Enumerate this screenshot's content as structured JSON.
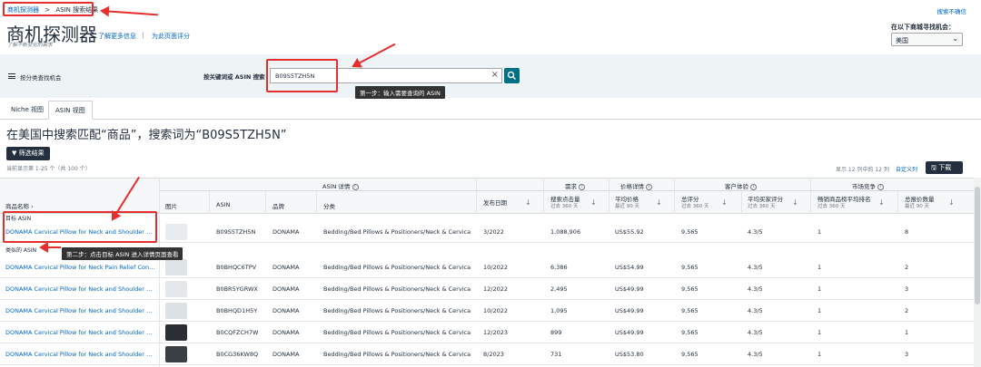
{
  "breadcrumb": {
    "home": "商机探测器",
    "sep": ">",
    "current": "ASIN 搜索结果"
  },
  "header": {
    "title": "商机探测器",
    "subtitle": "了解不断变化的需求",
    "learn_more": "了解更多信息",
    "divider": "|",
    "rate_page": "为此页面评分",
    "top_right_link": "搜索不确信",
    "marketplace_label": "在以下商城寻找机会：",
    "marketplace_value": "美国"
  },
  "searchbar": {
    "left_label": "按分类查找机会",
    "search_label": "按关键词或 ASIN 搜索",
    "search_value": "B09S5TZH5N",
    "step1_tip": "第一步：输入需要查询的 ASIN"
  },
  "tabs": [
    {
      "label": "Niche 视图"
    },
    {
      "label": "ASIN 视图"
    }
  ],
  "results": {
    "heading": "在美国中搜索匹配“商品”，搜索词为“B09S5TZH5N”",
    "filter_btn": "筛选结果",
    "count_text": "当前显示第 1-25 个（共 100 个）",
    "cols_text": "显示 12 列中的 12 列",
    "customize": "自定义列",
    "download": "下载"
  },
  "table": {
    "group_headers": {
      "asin_detail": "ASIN 详情",
      "demand": "需求",
      "price": "价格详情",
      "experience": "客户体验",
      "competition": "市场竞争"
    },
    "columns": {
      "name": "商品名称",
      "image": "图片",
      "asin": "ASIN",
      "brand": "品牌",
      "category": "分类",
      "launch": "发布日期",
      "search_volume": "搜索点击量",
      "search_volume_sub": "过去 360 天",
      "avg_price": "平均价格",
      "avg_price_sub": "最近 90 天",
      "total_ratings": "总评分",
      "total_ratings_sub": "过去 360 天",
      "avg_rating": "平均买家评分",
      "avg_rating_sub": "过去 360 天",
      "bsr": "畅销商品榜平均排名",
      "bsr_sub": "过去 360 天",
      "sellers": "总报价数量",
      "sellers_sub": "最近 90 天"
    },
    "target_label": "目标 ASIN",
    "similar_label": "类似的 ASIN",
    "step2_tip": "第二步：点击目标 ASIN 进入详情页面查看",
    "rows": [
      {
        "name": "DONAMA Cervical Pillow for Neck and Shoulder Co...",
        "asin": "B09S5TZH5N",
        "brand": "DONAMA",
        "category": "Bedding/Bed Pillows & Positioners/Neck & Cervical...",
        "launch": "3/2022",
        "volume": "1,088,906",
        "price": "US$55.92",
        "ratings": "9,565",
        "rating": "4.3/5",
        "bsr": "1",
        "offers": "8",
        "thumb": "#e8ecee"
      },
      {
        "name": "DONAMA Cervical Pillow for Neck Pain Relief Cont...",
        "asin": "B0BHQC6TPV",
        "brand": "DONAMA",
        "category": "Bedding/Bed Pillows & Positioners/Neck & Cervical...",
        "launch": "10/2022",
        "volume": "6,386",
        "price": "US$54.99",
        "ratings": "9,565",
        "rating": "4.3/5",
        "bsr": "1",
        "offers": "2",
        "thumb": "#dfe4e6"
      },
      {
        "name": "DONAMA Cervical Pillow for Neck and Shoulder Co...",
        "asin": "B0BR5YGRWX",
        "brand": "DONAMA",
        "category": "Bedding/Bed Pillows & Positioners/Neck & Cervical...",
        "launch": "12/2022",
        "volume": "2,495",
        "price": "US$49.99",
        "ratings": "9,565",
        "rating": "4.3/5",
        "bsr": "1",
        "offers": "3",
        "thumb": "#e4e8ea"
      },
      {
        "name": "DONAMA Cervical Pillow for Neck and Shoulder Co...",
        "asin": "B0BHQD1H5Y",
        "brand": "DONAMA",
        "category": "Bedding/Bed Pillows & Positioners/Neck & Cervical...",
        "launch": "10/2022",
        "volume": "1,095",
        "price": "US$49.99",
        "ratings": "9,565",
        "rating": "4.3/5",
        "bsr": "1",
        "offers": "2",
        "thumb": "#dde2e4"
      },
      {
        "name": "DONAMA Cervical Pillow for Neck and Shoulder Co...",
        "asin": "B0CQFZCH7W",
        "brand": "DONAMA",
        "category": "Bedding/Bed Pillows & Positioners/Neck & Cervical...",
        "launch": "12/2023",
        "volume": "899",
        "price": "US$49.99",
        "ratings": "9,565",
        "rating": "4.3/5",
        "bsr": "1",
        "offers": "1",
        "thumb": "#2a2e33"
      },
      {
        "name": "DONAMA Cervical Pillow for Neck and Shoulder Co...",
        "asin": "B0CG36KW8Q",
        "brand": "DONAMA",
        "category": "Bedding/Bed Pillows & Positioners/Neck & Cervical...",
        "launch": "8/2023",
        "volume": "731",
        "price": "US$53.80",
        "ratings": "9,565",
        "rating": "4.3/5",
        "bsr": "1",
        "offers": "3",
        "thumb": "#3a3f44"
      }
    ]
  },
  "colors": {
    "accent": "#0066c0",
    "dark": "#232f3e",
    "teal": "#007185",
    "annotation": "#e62e2e"
  },
  "icons": {
    "menu": "hamburger-icon",
    "clear": "close-icon",
    "search": "search-icon",
    "filter": "filter-icon",
    "download": "download-icon"
  }
}
